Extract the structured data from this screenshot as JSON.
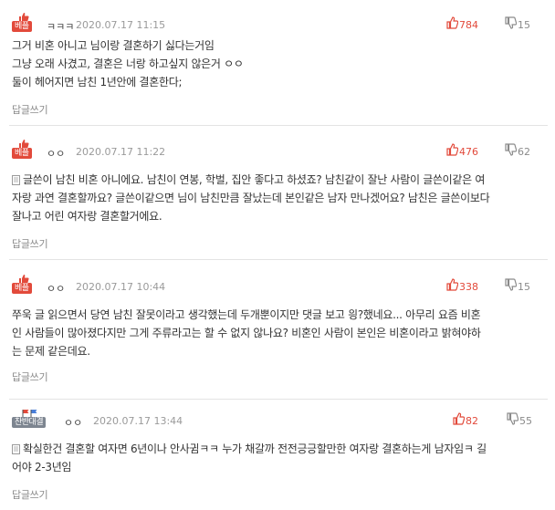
{
  "reply_label": "답글쓰기",
  "comments": [
    {
      "badge": "베플",
      "author": "ㅋㅋㅋ",
      "date": "2020.07.17 11:15",
      "up": "784",
      "down": "15",
      "lines": [
        "그거 비혼 아니고 님이랑 결혼하기 싫다는거임",
        "그냥 오래 사겼고, 결혼은 너랑 하고싶지 않은거 ㅇㅇ",
        "둘이 헤어지면 남친 1년안에 결혼한다;"
      ]
    },
    {
      "badge": "베플",
      "author": "ㅇㅇ",
      "date": "2020.07.17 11:22",
      "up": "476",
      "down": "62",
      "lines": [
        "글쓴이 남친 비혼 아니에요. 남친이 연봉, 학벌, 집안 좋다고 하셨죠? 남친같이 잘난 사람이 글쓴이같은 여",
        "자랑 과연 결혼할까요? 글쓴이같으면 님이 남친만큼 잘났는데 본인같은 남자 만나겠어요? 남친은 글쓴이보다",
        "잘나고 어린 여자랑 결혼할거에요."
      ]
    },
    {
      "badge": "베플",
      "author": "ㅇㅇ",
      "date": "2020.07.17 10:44",
      "up": "338",
      "down": "15",
      "lines": [
        "쭈욱 글 읽으면서 당연 남친 잘못이라고 생각했는데 두개뿐이지만 댓글 보고 읭?했네요... 아무리 요즘 비혼",
        "인 사람들이 많아졌다지만 그게 주류라고는 할 수 없지 않나요? 비혼인 사람이 본인은 비혼이라고 밝혀야하",
        "는 문제 같은데요."
      ]
    },
    {
      "badge": "찬반대결",
      "author": "ㅇㅇ",
      "date": "2020.07.17 13:44",
      "up": "82",
      "down": "55",
      "lines": [
        "확실한건 결혼할 여자면 6년이나 안사귐ㅋㅋ 누가 채갈까 전전긍긍할만한 여자랑 결혼하는게 남자임ㅋ 길",
        "어야 2-3년임"
      ]
    }
  ]
}
